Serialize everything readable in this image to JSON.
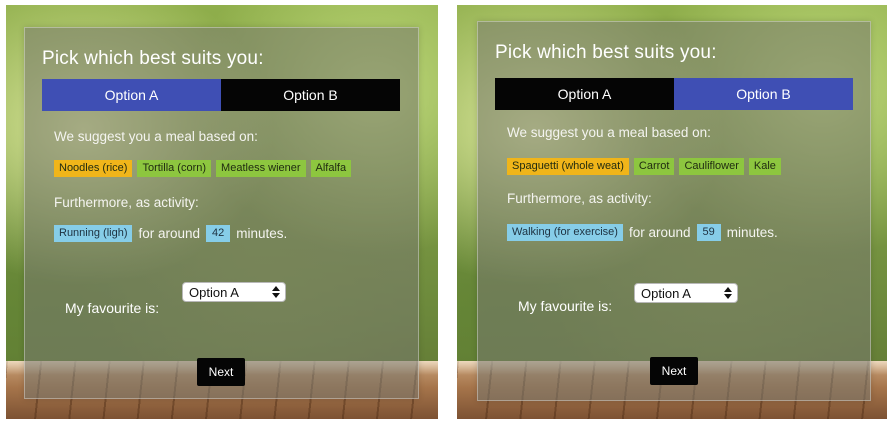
{
  "panels": [
    {
      "title": "Pick which best suits you:",
      "tabs": [
        {
          "label": "Option A",
          "state": "active"
        },
        {
          "label": "Option B",
          "state": "inactive"
        }
      ],
      "meal_intro": "We suggest you a meal based on:",
      "meal_tags": [
        {
          "label": "Noodles (rice)",
          "color": "#f0b51a"
        },
        {
          "label": "Tortilla (corn)",
          "color": "#8dc63f"
        },
        {
          "label": "Meatless wiener",
          "color": "#8dc63f"
        },
        {
          "label": "Alfalfa",
          "color": "#8dc63f"
        }
      ],
      "activity_intro": "Furthermore, as activity:",
      "activity": "Running (ligh)",
      "for_around": "for around",
      "minutes_value": "42",
      "minutes_label": "minutes.",
      "favourite_label": "My favourite is:",
      "favourite_selected": "Option A",
      "next_label": "Next"
    },
    {
      "title": "Pick which best suits you:",
      "tabs": [
        {
          "label": "Option A",
          "state": "inactive"
        },
        {
          "label": "Option B",
          "state": "active"
        }
      ],
      "meal_intro": "We suggest you a meal based on:",
      "meal_tags": [
        {
          "label": "Spaguetti (whole weat)",
          "color": "#f0b51a"
        },
        {
          "label": "Carrot",
          "color": "#8dc63f"
        },
        {
          "label": "Cauliflower",
          "color": "#8dc63f"
        },
        {
          "label": "Kale",
          "color": "#8dc63f"
        }
      ],
      "activity_intro": "Furthermore, as activity:",
      "activity": "Walking (for exercise)",
      "for_around": "for around",
      "minutes_value": "59",
      "minutes_label": "minutes.",
      "favourite_label": "My favourite is:",
      "favourite_selected": "Option A",
      "next_label": "Next"
    }
  ],
  "colors": {
    "tab_active": "#3f4fb4",
    "tab_inactive": "#050505",
    "tag_orange": "#f0b51a",
    "tag_green": "#8dc63f",
    "tag_blue": "#86cde8"
  }
}
